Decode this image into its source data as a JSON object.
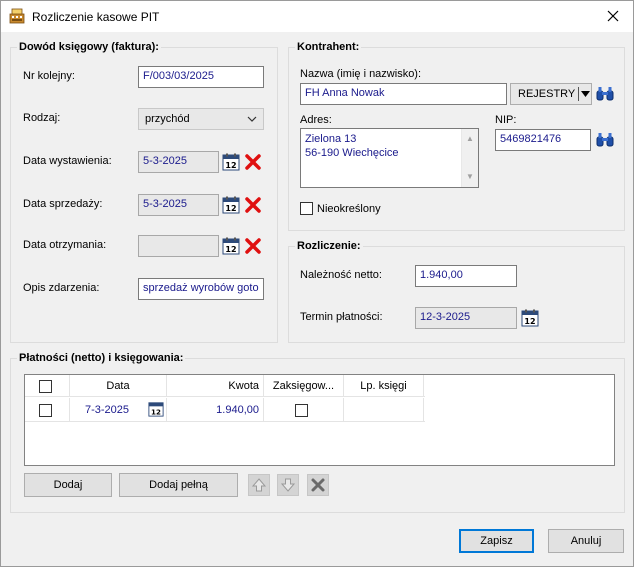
{
  "window": {
    "title": "Rozliczenie kasowe PIT"
  },
  "dowod": {
    "group_title": "Dowód księgowy (faktura):",
    "nr_label": "Nr kolejny:",
    "nr_value": "F/003/03/2025",
    "rodzaj_label": "Rodzaj:",
    "rodzaj_value": "przychód",
    "data_wyst_label": "Data wystawienia:",
    "data_wyst_value": "5-3-2025",
    "data_sprz_label": "Data sprzedaży:",
    "data_sprz_value": "5-3-2025",
    "data_otrz_label": "Data otrzymania:",
    "data_otrz_value": "",
    "opis_label": "Opis zdarzenia:",
    "opis_value": "sprzedaż wyrobów goto"
  },
  "kontrahent": {
    "group_title": "Kontrahent:",
    "nazwa_label": "Nazwa (imię i nazwisko):",
    "nazwa_value": "FH Anna Nowak",
    "rejestry_label": "REJESTRY",
    "adres_label": "Adres:",
    "adres_line1": "Zielona 13",
    "adres_line2": "56-190 Wiechęcice",
    "nip_label": "NIP:",
    "nip_value": "5469821476",
    "nieokreslony_label": "Nieokreślony"
  },
  "rozliczenie": {
    "group_title": "Rozliczenie:",
    "netto_label": "Należność netto:",
    "netto_value": "1.940,00",
    "termin_label": "Termin płatności:",
    "termin_value": "12-3-2025"
  },
  "platnosci": {
    "group_title": "Płatności (netto) i księgowania:",
    "columns": [
      "Data",
      "Kwota",
      "Zaksięgow...",
      "Lp. księgi"
    ],
    "rows": [
      {
        "data": "7-3-2025",
        "kwota": "1.940,00",
        "lp": ""
      }
    ],
    "dodaj_label": "Dodaj",
    "dodaj_pelna_label": "Dodaj pełną"
  },
  "footer": {
    "zapisz_label": "Zapisz",
    "anuluj_label": "Anuluj"
  },
  "colors": {
    "value_text": "#1a1a8c",
    "delete_red": "#e01010",
    "primary_border": "#0078d7"
  }
}
